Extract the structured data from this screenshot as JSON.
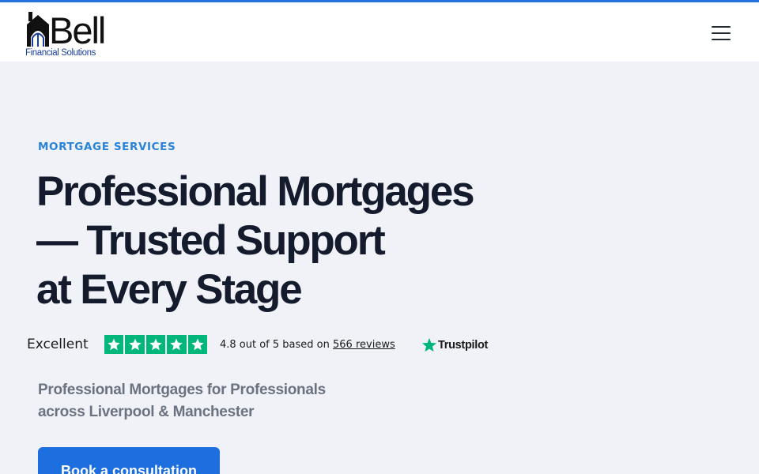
{
  "header": {
    "logo": {
      "wordmark": "Bell",
      "tagline": "Financial Solutions"
    },
    "menu_icon": "hamburger-icon"
  },
  "hero": {
    "eyebrow": "MORTGAGE SERVICES",
    "headline_lines": [
      "Professional Mortgages",
      "— Trusted Support",
      "at Every Stage"
    ],
    "subtext_lines": [
      "Professional Mortgages for Professionals",
      "across Liverpool & Manchester"
    ],
    "cta_label": "Book a consultation"
  },
  "trustpilot": {
    "rating_word": "Excellent",
    "stars": 5,
    "score_prefix": "4.8 out of 5 based on",
    "reviews_link": "566 reviews",
    "brand": "Trustpilot"
  },
  "colors": {
    "accent_bar": "#2472db",
    "eyebrow": "#2a83d6",
    "headline": "#141b2d",
    "trustpilot_green": "#00b67a",
    "cta_bg": "#1d6fe0",
    "page_bg": "#f0f2f7"
  }
}
